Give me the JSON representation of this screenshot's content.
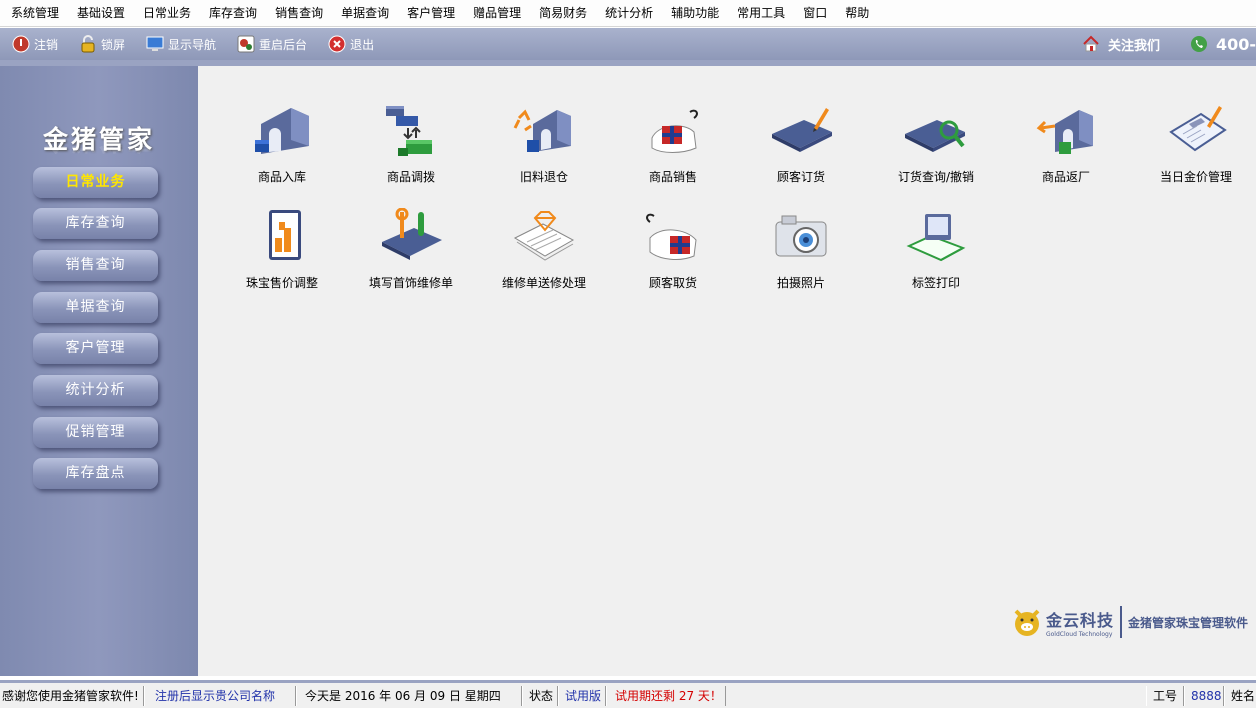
{
  "menu": [
    "系统管理",
    "基础设置",
    "日常业务",
    "库存查询",
    "销售查询",
    "单据查询",
    "客户管理",
    "赠品管理",
    "简易财务",
    "统计分析",
    "辅助功能",
    "常用工具",
    "窗口",
    "帮助"
  ],
  "toolbar": {
    "logout": "注销",
    "lock": "锁屏",
    "show_nav": "显示导航",
    "restart": "重启后台",
    "exit": "退出",
    "follow": "关注我们",
    "phone": "400-"
  },
  "sidebar": {
    "logo": "金猪管家",
    "items": [
      "日常业务",
      "库存查询",
      "销售查询",
      "单据查询",
      "客户管理",
      "统计分析",
      "促销管理",
      "库存盘点"
    ]
  },
  "tiles": [
    "商品入库",
    "商品调拨",
    "旧料退仓",
    "商品销售",
    "顾客订货",
    "订货查询/撤销",
    "商品返厂",
    "当日金价管理",
    "珠宝售价调整",
    "填写首饰维修单",
    "维修单送修处理",
    "顾客取货",
    "拍摄照片",
    "标签打印"
  ],
  "brand": {
    "company": "金云科技",
    "company_en": "GoldCloud Technology",
    "tagline": "金猪管家珠宝管理软件"
  },
  "status": {
    "thanks": "感谢您使用金猪管家软件!",
    "register": "注册后显示贵公司名称",
    "today": "今天是   2016 年 06 月 09 日  星期四",
    "state_label": "状态",
    "state_value": "试用版",
    "trial": "试用期还剩 27 天！",
    "job_label": "工号",
    "job_value": "8888",
    "name_label": "姓名"
  },
  "colors": {
    "accent": "#8e98b8",
    "active_nav": "#ffe600",
    "trial_red": "#d40000",
    "brand_blue": "#4a5a8c"
  }
}
